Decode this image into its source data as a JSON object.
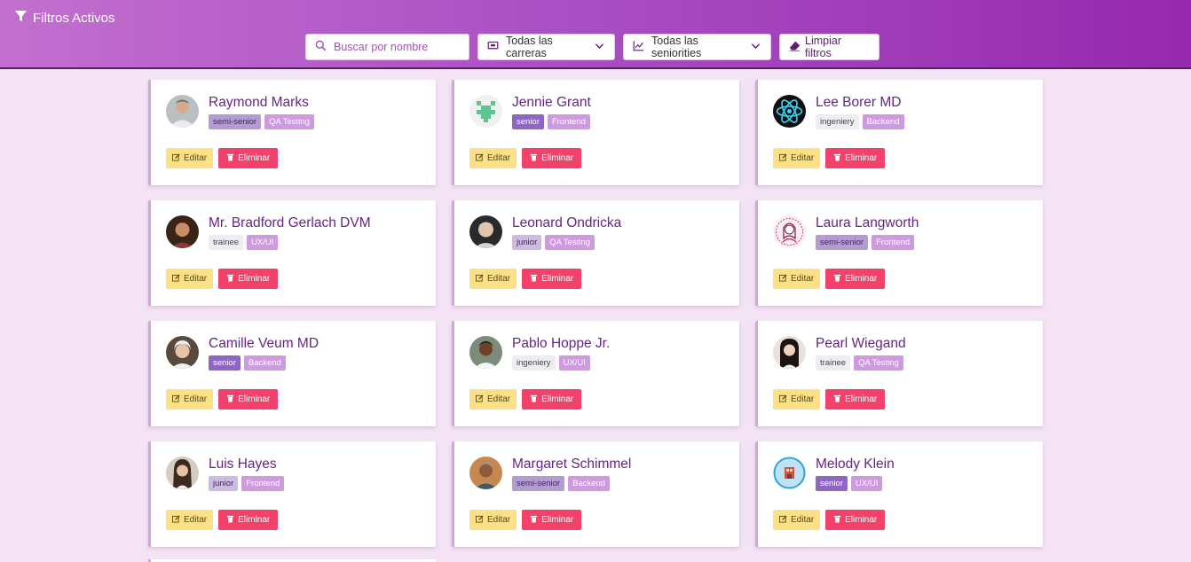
{
  "header": {
    "title": "Filtros Activos",
    "search_placeholder": "Buscar por nombre",
    "career_select": "Todas las carreras",
    "seniority_select": "Todas las seniorities",
    "clear_label": "Limpiar filtros"
  },
  "buttons": {
    "edit": "Editar",
    "delete": "Eliminar"
  },
  "colors": {
    "header_gradient_start": "#c36fcf",
    "header_gradient_end": "#9629ad",
    "page_background": "#f4e3f5",
    "name_color": "#66248a",
    "edit_button": "#fbe086",
    "delete_button": "#f2426b"
  },
  "cards": [
    {
      "name": "Raymond Marks",
      "seniority": "semi-senior",
      "career": "QA Testing"
    },
    {
      "name": "Jennie Grant",
      "seniority": "senior",
      "career": "Frontend"
    },
    {
      "name": "Lee Borer MD",
      "seniority": "ingeniery",
      "career": "Backend"
    },
    {
      "name": "Mr. Bradford Gerlach DVM",
      "seniority": "trainee",
      "career": "UX/UI"
    },
    {
      "name": "Leonard Ondricka",
      "seniority": "junior",
      "career": "QA Testing"
    },
    {
      "name": "Laura Langworth",
      "seniority": "semi-senior",
      "career": "Frontend"
    },
    {
      "name": "Camille Veum MD",
      "seniority": "senior",
      "career": "Backend"
    },
    {
      "name": "Pablo Hoppe Jr.",
      "seniority": "ingeniery",
      "career": "UX/UI"
    },
    {
      "name": "Pearl Wiegand",
      "seniority": "trainee",
      "career": "QA Testing"
    },
    {
      "name": "Luis Hayes",
      "seniority": "junior",
      "career": "Frontend"
    },
    {
      "name": "Margaret Schimmel",
      "seniority": "semi-senior",
      "career": "Backend"
    },
    {
      "name": "Melody Klein",
      "seniority": "senior",
      "career": "UX/UI"
    }
  ]
}
